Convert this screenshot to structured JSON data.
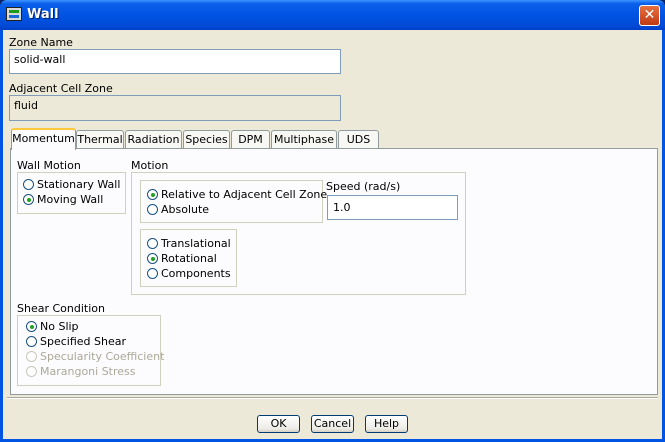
{
  "window": {
    "title": "Wall",
    "close_glyph": "✕"
  },
  "zone_name": {
    "label": "Zone Name",
    "value": "solid-wall"
  },
  "adjacent_cell_zone": {
    "label": "Adjacent Cell Zone",
    "value": "fluid"
  },
  "tabs": [
    {
      "label": "Momentum",
      "active": true
    },
    {
      "label": "Thermal"
    },
    {
      "label": "Radiation"
    },
    {
      "label": "Species"
    },
    {
      "label": "DPM"
    },
    {
      "label": "Multiphase"
    },
    {
      "label": "UDS"
    }
  ],
  "wall_motion": {
    "label": "Wall Motion",
    "options": [
      {
        "label": "Stationary Wall",
        "selected": false
      },
      {
        "label": "Moving Wall",
        "selected": true
      }
    ]
  },
  "motion": {
    "label": "Motion",
    "reference": [
      {
        "label": "Relative to Adjacent Cell Zone",
        "selected": true
      },
      {
        "label": "Absolute",
        "selected": false
      }
    ],
    "type": [
      {
        "label": "Translational",
        "selected": false
      },
      {
        "label": "Rotational",
        "selected": true
      },
      {
        "label": "Components",
        "selected": false
      }
    ],
    "speed_label": "Speed (rad/s)",
    "speed_value": "1.0"
  },
  "shear_condition": {
    "label": "Shear Condition",
    "options": [
      {
        "label": "No Slip",
        "selected": true,
        "enabled": true
      },
      {
        "label": "Specified Shear",
        "selected": false,
        "enabled": true
      },
      {
        "label": "Specularity Coefficient",
        "selected": false,
        "enabled": false
      },
      {
        "label": "Marangoni Stress",
        "selected": false,
        "enabled": false
      }
    ]
  },
  "buttons": {
    "ok": "OK",
    "cancel": "Cancel",
    "help": "Help"
  }
}
